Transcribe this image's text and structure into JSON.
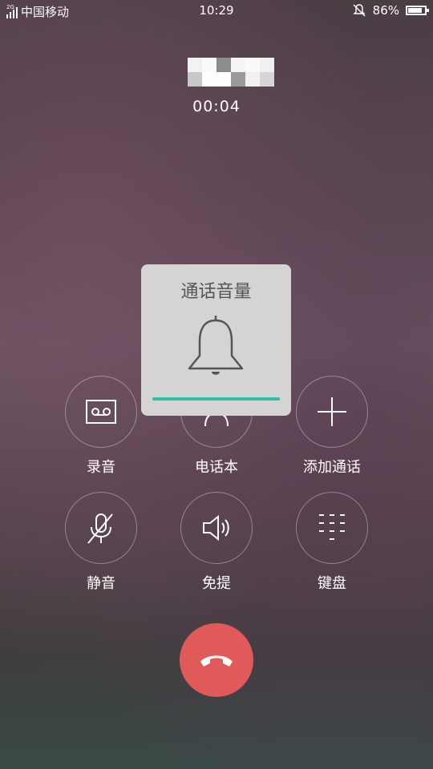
{
  "status_bar": {
    "network": "2G",
    "carrier": "中国移动",
    "time": "10:29",
    "battery_percent": "86%",
    "battery_level": 0.86
  },
  "call": {
    "duration": "00:04"
  },
  "controls": {
    "record": "录音",
    "contacts": "电话本",
    "add_call": "添加通话",
    "mute": "静音",
    "speaker": "免提",
    "keypad": "键盘"
  },
  "volume_popup": {
    "title": "通话音量",
    "level": 1.0,
    "accent_color": "#2fc0a8"
  },
  "colors": {
    "hangup": "#e05a5a"
  },
  "icons": [
    "signal-icon",
    "silent-icon",
    "battery-icon",
    "record-icon",
    "contacts-icon",
    "add-icon",
    "mute-icon",
    "speaker-icon",
    "keypad-icon",
    "hangup-icon",
    "bell-icon"
  ]
}
